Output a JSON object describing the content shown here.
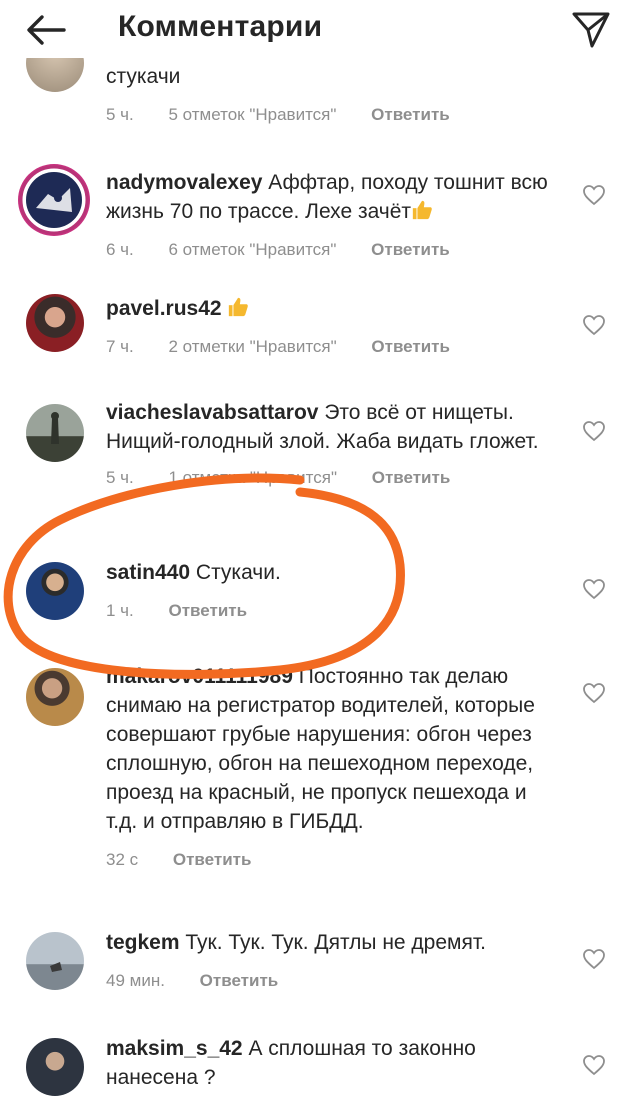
{
  "header": {
    "title": "Комментарии"
  },
  "comments": [
    {
      "username": "",
      "text": "стукачи",
      "time": "5 ч.",
      "likes": "5 отметок \"Нравится\"",
      "reply": "Ответить"
    },
    {
      "username": "nadymovalexey",
      "text": "Аффтар, походу тошнит всю жизнь 70 по трассе. Лехе зачёт",
      "time": "6 ч.",
      "likes": "6 отметок \"Нравится\"",
      "reply": "Ответить"
    },
    {
      "username": "pavel.rus42",
      "text": "",
      "time": "7 ч.",
      "likes": "2 отметки \"Нравится\"",
      "reply": "Ответить"
    },
    {
      "username": "viacheslavabsattarov",
      "text": "Это всё от нищеты. Нищий-голодный злой. Жаба видать гложет.",
      "time": "5 ч.",
      "likes": "1 отметка \"Нравится\"",
      "reply": "Ответить"
    },
    {
      "username": "satin440",
      "text": "Стукачи.",
      "time": "1 ч.",
      "reply": "Ответить"
    },
    {
      "username": "makarov011111989",
      "text": "Постоянно так делаю снимаю на регистратор водителей, которые совершают грубые нарушения: обгон через сплошную, обгон на пешеходном переходе, проезд на красный, не пропуск пешехода и т.д. и отправляю в ГИБДД.",
      "time": "32 с",
      "reply": "Ответить"
    },
    {
      "username": "tegkem",
      "text": "Тук. Тук. Тук. Дятлы не дремят.",
      "time": "49 мин.",
      "reply": "Ответить"
    },
    {
      "username": "maksim_s_42",
      "text": "А сплошная то законно нанесена ?",
      "time": "",
      "reply": ""
    }
  ],
  "colors": {
    "text": "#262626",
    "secondary": "#8e8e8e",
    "highlight_circle": "#f26a21",
    "thumbs_up": "#f5b82e"
  }
}
